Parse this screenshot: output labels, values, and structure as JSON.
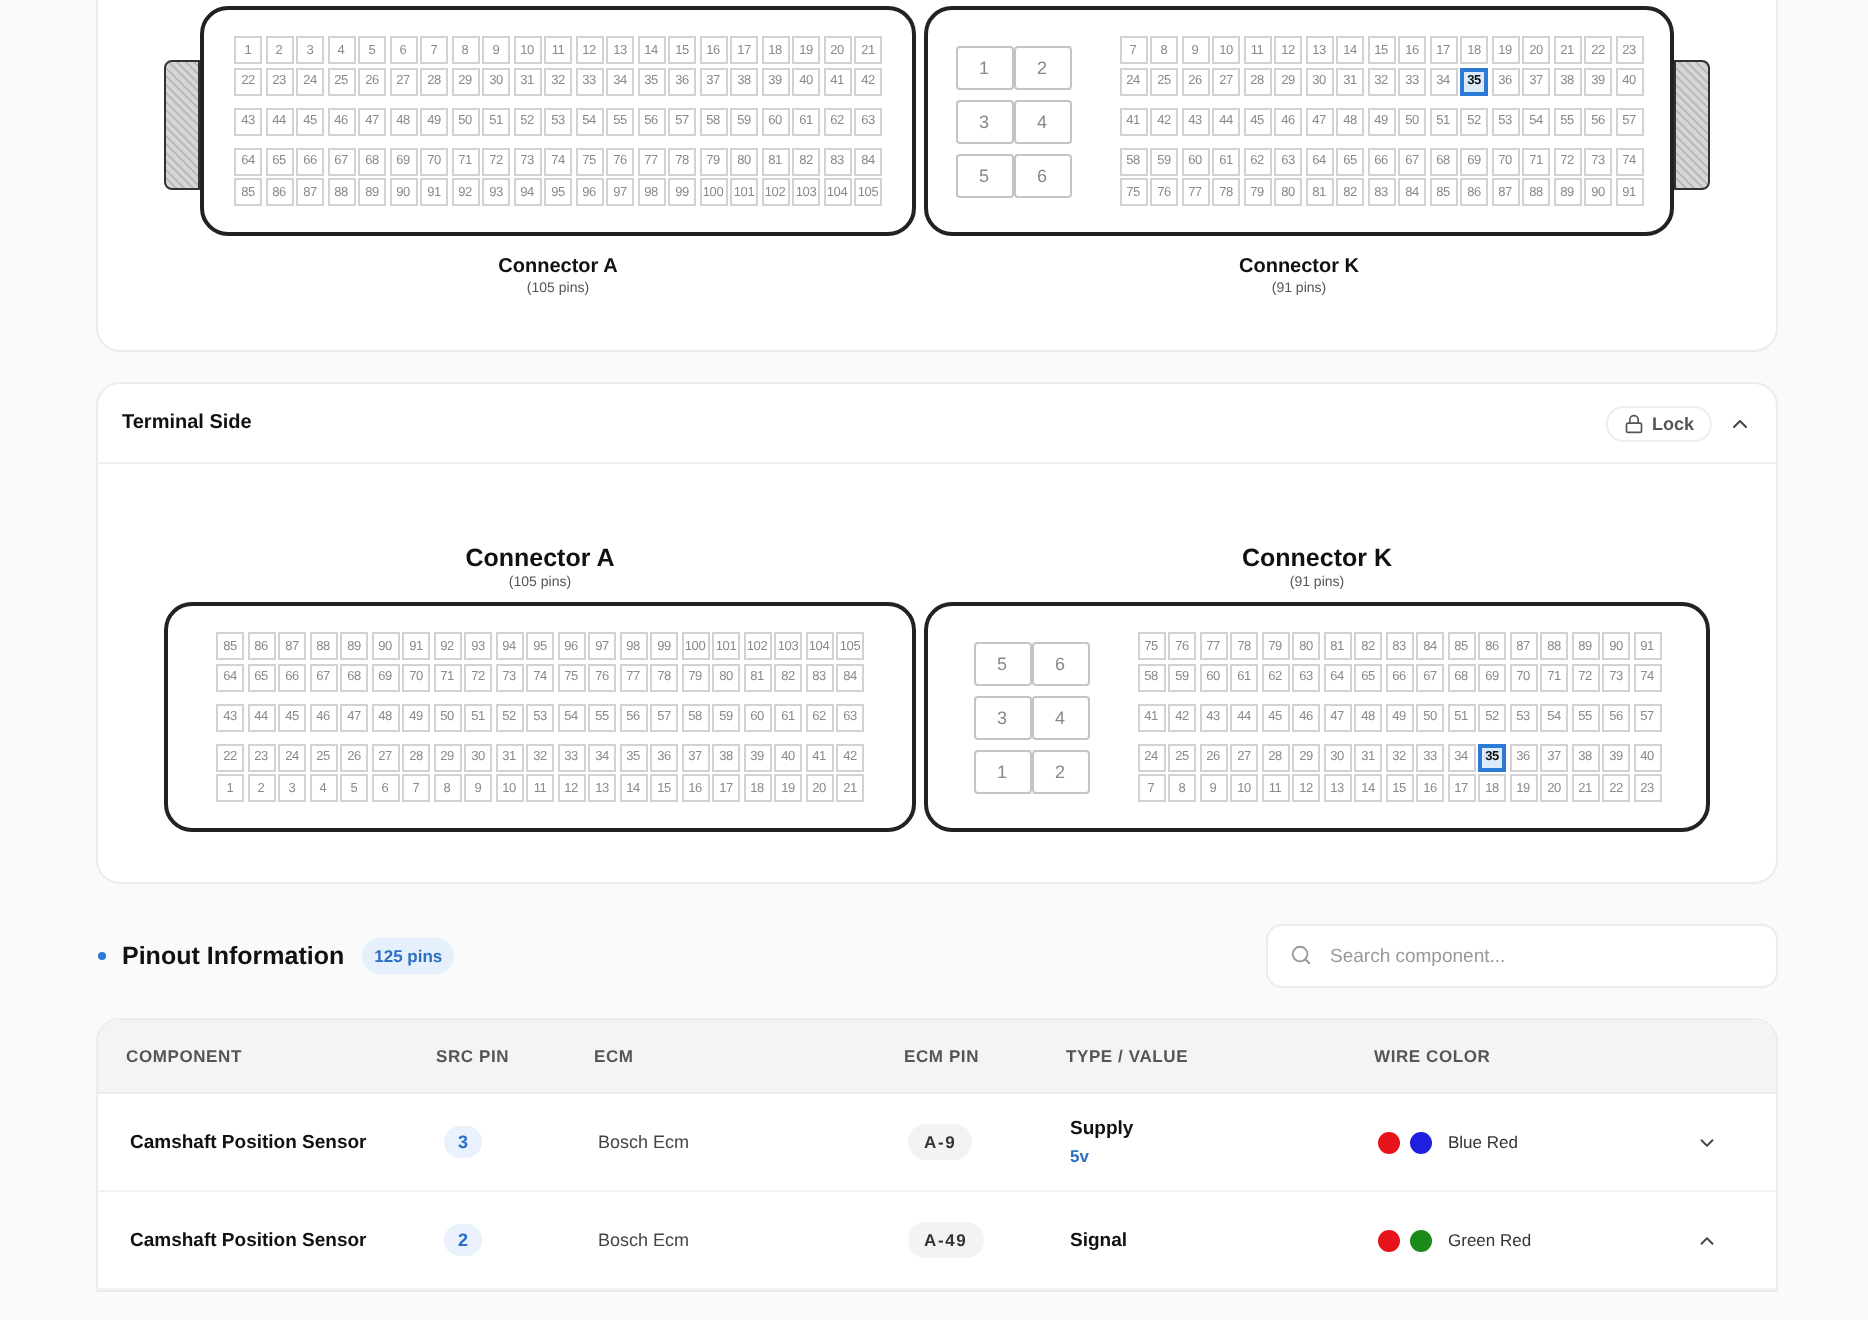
{
  "wiring_panel": {
    "labels_above": false,
    "connectors": [
      {
        "name": "Connector A",
        "pin_count": "(105 pins)",
        "latch_left": true,
        "latch_right": false,
        "groups": [
          [
            [
              {
                "n": "1",
                "selected": false
              },
              {
                "n": "2",
                "selected": false
              },
              {
                "n": "3",
                "selected": false
              },
              {
                "n": "4",
                "selected": false
              },
              {
                "n": "5",
                "selected": false
              },
              {
                "n": "6",
                "selected": false
              },
              {
                "n": "7",
                "selected": false
              },
              {
                "n": "8",
                "selected": false
              },
              {
                "n": "9",
                "selected": false
              },
              {
                "n": "10",
                "selected": false
              },
              {
                "n": "11",
                "selected": false
              },
              {
                "n": "12",
                "selected": false
              },
              {
                "n": "13",
                "selected": false
              },
              {
                "n": "14",
                "selected": false
              },
              {
                "n": "15",
                "selected": false
              },
              {
                "n": "16",
                "selected": false
              },
              {
                "n": "17",
                "selected": false
              },
              {
                "n": "18",
                "selected": false
              },
              {
                "n": "19",
                "selected": false
              },
              {
                "n": "20",
                "selected": false
              },
              {
                "n": "21",
                "selected": false
              }
            ],
            [
              {
                "n": "22",
                "selected": false
              },
              {
                "n": "23",
                "selected": false
              },
              {
                "n": "24",
                "selected": false
              },
              {
                "n": "25",
                "selected": false
              },
              {
                "n": "26",
                "selected": false
              },
              {
                "n": "27",
                "selected": false
              },
              {
                "n": "28",
                "selected": false
              },
              {
                "n": "29",
                "selected": false
              },
              {
                "n": "30",
                "selected": false
              },
              {
                "n": "31",
                "selected": false
              },
              {
                "n": "32",
                "selected": false
              },
              {
                "n": "33",
                "selected": false
              },
              {
                "n": "34",
                "selected": false
              },
              {
                "n": "35",
                "selected": false
              },
              {
                "n": "36",
                "selected": false
              },
              {
                "n": "37",
                "selected": false
              },
              {
                "n": "38",
                "selected": false
              },
              {
                "n": "39",
                "selected": false
              },
              {
                "n": "40",
                "selected": false
              },
              {
                "n": "41",
                "selected": false
              },
              {
                "n": "42",
                "selected": false
              }
            ]
          ],
          [
            [
              {
                "n": "43",
                "selected": false
              },
              {
                "n": "44",
                "selected": false
              },
              {
                "n": "45",
                "selected": false
              },
              {
                "n": "46",
                "selected": false
              },
              {
                "n": "47",
                "selected": false
              },
              {
                "n": "48",
                "selected": false
              },
              {
                "n": "49",
                "selected": false
              },
              {
                "n": "50",
                "selected": false
              },
              {
                "n": "51",
                "selected": false
              },
              {
                "n": "52",
                "selected": false
              },
              {
                "n": "53",
                "selected": false
              },
              {
                "n": "54",
                "selected": false
              },
              {
                "n": "55",
                "selected": false
              },
              {
                "n": "56",
                "selected": false
              },
              {
                "n": "57",
                "selected": false
              },
              {
                "n": "58",
                "selected": false
              },
              {
                "n": "59",
                "selected": false
              },
              {
                "n": "60",
                "selected": false
              },
              {
                "n": "61",
                "selected": false
              },
              {
                "n": "62",
                "selected": false
              },
              {
                "n": "63",
                "selected": false
              }
            ]
          ],
          [
            [
              {
                "n": "64",
                "selected": false
              },
              {
                "n": "65",
                "selected": false
              },
              {
                "n": "66",
                "selected": false
              },
              {
                "n": "67",
                "selected": false
              },
              {
                "n": "68",
                "selected": false
              },
              {
                "n": "69",
                "selected": false
              },
              {
                "n": "70",
                "selected": false
              },
              {
                "n": "71",
                "selected": false
              },
              {
                "n": "72",
                "selected": false
              },
              {
                "n": "73",
                "selected": false
              },
              {
                "n": "74",
                "selected": false
              },
              {
                "n": "75",
                "selected": false
              },
              {
                "n": "76",
                "selected": false
              },
              {
                "n": "77",
                "selected": false
              },
              {
                "n": "78",
                "selected": false
              },
              {
                "n": "79",
                "selected": false
              },
              {
                "n": "80",
                "selected": false
              },
              {
                "n": "81",
                "selected": false
              },
              {
                "n": "82",
                "selected": false
              },
              {
                "n": "83",
                "selected": false
              },
              {
                "n": "84",
                "selected": false
              }
            ],
            [
              {
                "n": "85",
                "selected": false
              },
              {
                "n": "86",
                "selected": false
              },
              {
                "n": "87",
                "selected": false
              },
              {
                "n": "88",
                "selected": false
              },
              {
                "n": "89",
                "selected": false
              },
              {
                "n": "90",
                "selected": false
              },
              {
                "n": "91",
                "selected": false
              },
              {
                "n": "92",
                "selected": false
              },
              {
                "n": "93",
                "selected": false
              },
              {
                "n": "94",
                "selected": false
              },
              {
                "n": "95",
                "selected": false
              },
              {
                "n": "96",
                "selected": false
              },
              {
                "n": "97",
                "selected": false
              },
              {
                "n": "98",
                "selected": false
              },
              {
                "n": "99",
                "selected": false
              },
              {
                "n": "100",
                "selected": false
              },
              {
                "n": "101",
                "selected": false
              },
              {
                "n": "102",
                "selected": false
              },
              {
                "n": "103",
                "selected": false
              },
              {
                "n": "104",
                "selected": false
              },
              {
                "n": "105",
                "selected": false
              }
            ]
          ]
        ]
      },
      {
        "name": "Connector K",
        "pin_count": "(91 pins)",
        "latch_left": false,
        "latch_right": true,
        "large_pins": [
          [
            "1",
            "2"
          ],
          [
            "3",
            "4"
          ],
          [
            "5",
            "6"
          ]
        ],
        "groups": [
          [
            [
              {
                "n": "7",
                "selected": false
              },
              {
                "n": "8",
                "selected": false
              },
              {
                "n": "9",
                "selected": false
              },
              {
                "n": "10",
                "selected": false
              },
              {
                "n": "11",
                "selected": false
              },
              {
                "n": "12",
                "selected": false
              },
              {
                "n": "13",
                "selected": false
              },
              {
                "n": "14",
                "selected": false
              },
              {
                "n": "15",
                "selected": false
              },
              {
                "n": "16",
                "selected": false
              },
              {
                "n": "17",
                "selected": false
              },
              {
                "n": "18",
                "selected": false
              },
              {
                "n": "19",
                "selected": false
              },
              {
                "n": "20",
                "selected": false
              },
              {
                "n": "21",
                "selected": false
              },
              {
                "n": "22",
                "selected": false
              },
              {
                "n": "23",
                "selected": false
              }
            ],
            [
              {
                "n": "24",
                "selected": false
              },
              {
                "n": "25",
                "selected": false
              },
              {
                "n": "26",
                "selected": false
              },
              {
                "n": "27",
                "selected": false
              },
              {
                "n": "28",
                "selected": false
              },
              {
                "n": "29",
                "selected": false
              },
              {
                "n": "30",
                "selected": false
              },
              {
                "n": "31",
                "selected": false
              },
              {
                "n": "32",
                "selected": false
              },
              {
                "n": "33",
                "selected": false
              },
              {
                "n": "34",
                "selected": false
              },
              {
                "n": "35",
                "selected": true
              },
              {
                "n": "36",
                "selected": false
              },
              {
                "n": "37",
                "selected": false
              },
              {
                "n": "38",
                "selected": false
              },
              {
                "n": "39",
                "selected": false
              },
              {
                "n": "40",
                "selected": false
              }
            ]
          ],
          [
            [
              {
                "n": "41",
                "selected": false
              },
              {
                "n": "42",
                "selected": false
              },
              {
                "n": "43",
                "selected": false
              },
              {
                "n": "44",
                "selected": false
              },
              {
                "n": "45",
                "selected": false
              },
              {
                "n": "46",
                "selected": false
              },
              {
                "n": "47",
                "selected": false
              },
              {
                "n": "48",
                "selected": false
              },
              {
                "n": "49",
                "selected": false
              },
              {
                "n": "50",
                "selected": false
              },
              {
                "n": "51",
                "selected": false
              },
              {
                "n": "52",
                "selected": false
              },
              {
                "n": "53",
                "selected": false
              },
              {
                "n": "54",
                "selected": false
              },
              {
                "n": "55",
                "selected": false
              },
              {
                "n": "56",
                "selected": false
              },
              {
                "n": "57",
                "selected": false
              }
            ]
          ],
          [
            [
              {
                "n": "58",
                "selected": false
              },
              {
                "n": "59",
                "selected": false
              },
              {
                "n": "60",
                "selected": false
              },
              {
                "n": "61",
                "selected": false
              },
              {
                "n": "62",
                "selected": false
              },
              {
                "n": "63",
                "selected": false
              },
              {
                "n": "64",
                "selected": false
              },
              {
                "n": "65",
                "selected": false
              },
              {
                "n": "66",
                "selected": false
              },
              {
                "n": "67",
                "selected": false
              },
              {
                "n": "68",
                "selected": false
              },
              {
                "n": "69",
                "selected": false
              },
              {
                "n": "70",
                "selected": false
              },
              {
                "n": "71",
                "selected": false
              },
              {
                "n": "72",
                "selected": false
              },
              {
                "n": "73",
                "selected": false
              },
              {
                "n": "74",
                "selected": false
              }
            ],
            [
              {
                "n": "75",
                "selected": false
              },
              {
                "n": "76",
                "selected": false
              },
              {
                "n": "77",
                "selected": false
              },
              {
                "n": "78",
                "selected": false
              },
              {
                "n": "79",
                "selected": false
              },
              {
                "n": "80",
                "selected": false
              },
              {
                "n": "81",
                "selected": false
              },
              {
                "n": "82",
                "selected": false
              },
              {
                "n": "83",
                "selected": false
              },
              {
                "n": "84",
                "selected": false
              },
              {
                "n": "85",
                "selected": false
              },
              {
                "n": "86",
                "selected": false
              },
              {
                "n": "87",
                "selected": false
              },
              {
                "n": "88",
                "selected": false
              },
              {
                "n": "89",
                "selected": false
              },
              {
                "n": "90",
                "selected": false
              },
              {
                "n": "91",
                "selected": false
              }
            ]
          ]
        ]
      }
    ]
  },
  "terminal_side": {
    "title": "Terminal Side",
    "lock_label": "Lock",
    "expanded": true,
    "labels_above": true,
    "connectors": [
      {
        "name": "Connector A",
        "pin_count": "(105 pins)",
        "latch_left": false,
        "latch_right": false,
        "groups": [
          [
            [
              {
                "n": "85",
                "selected": false
              },
              {
                "n": "86",
                "selected": false
              },
              {
                "n": "87",
                "selected": false
              },
              {
                "n": "88",
                "selected": false
              },
              {
                "n": "89",
                "selected": false
              },
              {
                "n": "90",
                "selected": false
              },
              {
                "n": "91",
                "selected": false
              },
              {
                "n": "92",
                "selected": false
              },
              {
                "n": "93",
                "selected": false
              },
              {
                "n": "94",
                "selected": false
              },
              {
                "n": "95",
                "selected": false
              },
              {
                "n": "96",
                "selected": false
              },
              {
                "n": "97",
                "selected": false
              },
              {
                "n": "98",
                "selected": false
              },
              {
                "n": "99",
                "selected": false
              },
              {
                "n": "100",
                "selected": false
              },
              {
                "n": "101",
                "selected": false
              },
              {
                "n": "102",
                "selected": false
              },
              {
                "n": "103",
                "selected": false
              },
              {
                "n": "104",
                "selected": false
              },
              {
                "n": "105",
                "selected": false
              }
            ],
            [
              {
                "n": "64",
                "selected": false
              },
              {
                "n": "65",
                "selected": false
              },
              {
                "n": "66",
                "selected": false
              },
              {
                "n": "67",
                "selected": false
              },
              {
                "n": "68",
                "selected": false
              },
              {
                "n": "69",
                "selected": false
              },
              {
                "n": "70",
                "selected": false
              },
              {
                "n": "71",
                "selected": false
              },
              {
                "n": "72",
                "selected": false
              },
              {
                "n": "73",
                "selected": false
              },
              {
                "n": "74",
                "selected": false
              },
              {
                "n": "75",
                "selected": false
              },
              {
                "n": "76",
                "selected": false
              },
              {
                "n": "77",
                "selected": false
              },
              {
                "n": "78",
                "selected": false
              },
              {
                "n": "79",
                "selected": false
              },
              {
                "n": "80",
                "selected": false
              },
              {
                "n": "81",
                "selected": false
              },
              {
                "n": "82",
                "selected": false
              },
              {
                "n": "83",
                "selected": false
              },
              {
                "n": "84",
                "selected": false
              }
            ]
          ],
          [
            [
              {
                "n": "43",
                "selected": false
              },
              {
                "n": "44",
                "selected": false
              },
              {
                "n": "45",
                "selected": false
              },
              {
                "n": "46",
                "selected": false
              },
              {
                "n": "47",
                "selected": false
              },
              {
                "n": "48",
                "selected": false
              },
              {
                "n": "49",
                "selected": false
              },
              {
                "n": "50",
                "selected": false
              },
              {
                "n": "51",
                "selected": false
              },
              {
                "n": "52",
                "selected": false
              },
              {
                "n": "53",
                "selected": false
              },
              {
                "n": "54",
                "selected": false
              },
              {
                "n": "55",
                "selected": false
              },
              {
                "n": "56",
                "selected": false
              },
              {
                "n": "57",
                "selected": false
              },
              {
                "n": "58",
                "selected": false
              },
              {
                "n": "59",
                "selected": false
              },
              {
                "n": "60",
                "selected": false
              },
              {
                "n": "61",
                "selected": false
              },
              {
                "n": "62",
                "selected": false
              },
              {
                "n": "63",
                "selected": false
              }
            ]
          ],
          [
            [
              {
                "n": "22",
                "selected": false
              },
              {
                "n": "23",
                "selected": false
              },
              {
                "n": "24",
                "selected": false
              },
              {
                "n": "25",
                "selected": false
              },
              {
                "n": "26",
                "selected": false
              },
              {
                "n": "27",
                "selected": false
              },
              {
                "n": "28",
                "selected": false
              },
              {
                "n": "29",
                "selected": false
              },
              {
                "n": "30",
                "selected": false
              },
              {
                "n": "31",
                "selected": false
              },
              {
                "n": "32",
                "selected": false
              },
              {
                "n": "33",
                "selected": false
              },
              {
                "n": "34",
                "selected": false
              },
              {
                "n": "35",
                "selected": false
              },
              {
                "n": "36",
                "selected": false
              },
              {
                "n": "37",
                "selected": false
              },
              {
                "n": "38",
                "selected": false
              },
              {
                "n": "39",
                "selected": false
              },
              {
                "n": "40",
                "selected": false
              },
              {
                "n": "41",
                "selected": false
              },
              {
                "n": "42",
                "selected": false
              }
            ],
            [
              {
                "n": "1",
                "selected": false
              },
              {
                "n": "2",
                "selected": false
              },
              {
                "n": "3",
                "selected": false
              },
              {
                "n": "4",
                "selected": false
              },
              {
                "n": "5",
                "selected": false
              },
              {
                "n": "6",
                "selected": false
              },
              {
                "n": "7",
                "selected": false
              },
              {
                "n": "8",
                "selected": false
              },
              {
                "n": "9",
                "selected": false
              },
              {
                "n": "10",
                "selected": false
              },
              {
                "n": "11",
                "selected": false
              },
              {
                "n": "12",
                "selected": false
              },
              {
                "n": "13",
                "selected": false
              },
              {
                "n": "14",
                "selected": false
              },
              {
                "n": "15",
                "selected": false
              },
              {
                "n": "16",
                "selected": false
              },
              {
                "n": "17",
                "selected": false
              },
              {
                "n": "18",
                "selected": false
              },
              {
                "n": "19",
                "selected": false
              },
              {
                "n": "20",
                "selected": false
              },
              {
                "n": "21",
                "selected": false
              }
            ]
          ]
        ]
      },
      {
        "name": "Connector K",
        "pin_count": "(91 pins)",
        "latch_left": false,
        "latch_right": false,
        "large_pins": [
          [
            "5",
            "6"
          ],
          [
            "3",
            "4"
          ],
          [
            "1",
            "2"
          ]
        ],
        "groups": [
          [
            [
              {
                "n": "75",
                "selected": false
              },
              {
                "n": "76",
                "selected": false
              },
              {
                "n": "77",
                "selected": false
              },
              {
                "n": "78",
                "selected": false
              },
              {
                "n": "79",
                "selected": false
              },
              {
                "n": "80",
                "selected": false
              },
              {
                "n": "81",
                "selected": false
              },
              {
                "n": "82",
                "selected": false
              },
              {
                "n": "83",
                "selected": false
              },
              {
                "n": "84",
                "selected": false
              },
              {
                "n": "85",
                "selected": false
              },
              {
                "n": "86",
                "selected": false
              },
              {
                "n": "87",
                "selected": false
              },
              {
                "n": "88",
                "selected": false
              },
              {
                "n": "89",
                "selected": false
              },
              {
                "n": "90",
                "selected": false
              },
              {
                "n": "91",
                "selected": false
              }
            ],
            [
              {
                "n": "58",
                "selected": false
              },
              {
                "n": "59",
                "selected": false
              },
              {
                "n": "60",
                "selected": false
              },
              {
                "n": "61",
                "selected": false
              },
              {
                "n": "62",
                "selected": false
              },
              {
                "n": "63",
                "selected": false
              },
              {
                "n": "64",
                "selected": false
              },
              {
                "n": "65",
                "selected": false
              },
              {
                "n": "66",
                "selected": false
              },
              {
                "n": "67",
                "selected": false
              },
              {
                "n": "68",
                "selected": false
              },
              {
                "n": "69",
                "selected": false
              },
              {
                "n": "70",
                "selected": false
              },
              {
                "n": "71",
                "selected": false
              },
              {
                "n": "72",
                "selected": false
              },
              {
                "n": "73",
                "selected": false
              },
              {
                "n": "74",
                "selected": false
              }
            ]
          ],
          [
            [
              {
                "n": "41",
                "selected": false
              },
              {
                "n": "42",
                "selected": false
              },
              {
                "n": "43",
                "selected": false
              },
              {
                "n": "44",
                "selected": false
              },
              {
                "n": "45",
                "selected": false
              },
              {
                "n": "46",
                "selected": false
              },
              {
                "n": "47",
                "selected": false
              },
              {
                "n": "48",
                "selected": false
              },
              {
                "n": "49",
                "selected": false
              },
              {
                "n": "50",
                "selected": false
              },
              {
                "n": "51",
                "selected": false
              },
              {
                "n": "52",
                "selected": false
              },
              {
                "n": "53",
                "selected": false
              },
              {
                "n": "54",
                "selected": false
              },
              {
                "n": "55",
                "selected": false
              },
              {
                "n": "56",
                "selected": false
              },
              {
                "n": "57",
                "selected": false
              }
            ]
          ],
          [
            [
              {
                "n": "24",
                "selected": false
              },
              {
                "n": "25",
                "selected": false
              },
              {
                "n": "26",
                "selected": false
              },
              {
                "n": "27",
                "selected": false
              },
              {
                "n": "28",
                "selected": false
              },
              {
                "n": "29",
                "selected": false
              },
              {
                "n": "30",
                "selected": false
              },
              {
                "n": "31",
                "selected": false
              },
              {
                "n": "32",
                "selected": false
              },
              {
                "n": "33",
                "selected": false
              },
              {
                "n": "34",
                "selected": false
              },
              {
                "n": "35",
                "selected": true
              },
              {
                "n": "36",
                "selected": false
              },
              {
                "n": "37",
                "selected": false
              },
              {
                "n": "38",
                "selected": false
              },
              {
                "n": "39",
                "selected": false
              },
              {
                "n": "40",
                "selected": false
              }
            ],
            [
              {
                "n": "7",
                "selected": false
              },
              {
                "n": "8",
                "selected": false
              },
              {
                "n": "9",
                "selected": false
              },
              {
                "n": "10",
                "selected": false
              },
              {
                "n": "11",
                "selected": false
              },
              {
                "n": "12",
                "selected": false
              },
              {
                "n": "13",
                "selected": false
              },
              {
                "n": "14",
                "selected": false
              },
              {
                "n": "15",
                "selected": false
              },
              {
                "n": "16",
                "selected": false
              },
              {
                "n": "17",
                "selected": false
              },
              {
                "n": "18",
                "selected": false
              },
              {
                "n": "19",
                "selected": false
              },
              {
                "n": "20",
                "selected": false
              },
              {
                "n": "21",
                "selected": false
              },
              {
                "n": "22",
                "selected": false
              },
              {
                "n": "23",
                "selected": false
              }
            ]
          ]
        ]
      }
    ]
  },
  "pinout": {
    "title": "Pinout Information",
    "count": "125 pins",
    "search": {
      "placeholder": "Search component..."
    },
    "columns": [
      "COMPONENT",
      "SRC PIN",
      "ECM",
      "ECM PIN",
      "TYPE / VALUE",
      "WIRE COLOR"
    ],
    "rows": [
      {
        "component": "Camshaft Position Sensor",
        "src_pin": "3",
        "ecm": "Bosch Ecm",
        "ecm_pin": "A-9",
        "type": "Supply",
        "value": "5v",
        "wires": [
          {
            "color": "#e8141b"
          },
          {
            "color": "#1f1fe0"
          }
        ],
        "wire_label": "Blue Red",
        "expanded": false
      },
      {
        "component": "Camshaft Position Sensor",
        "src_pin": "2",
        "ecm": "Bosch Ecm",
        "ecm_pin": "A-49",
        "type": "Signal",
        "wires": [
          {
            "color": "#e8141b"
          },
          {
            "color": "#1a8a1a"
          }
        ],
        "wire_label": "Green Red",
        "expanded": true
      }
    ]
  }
}
